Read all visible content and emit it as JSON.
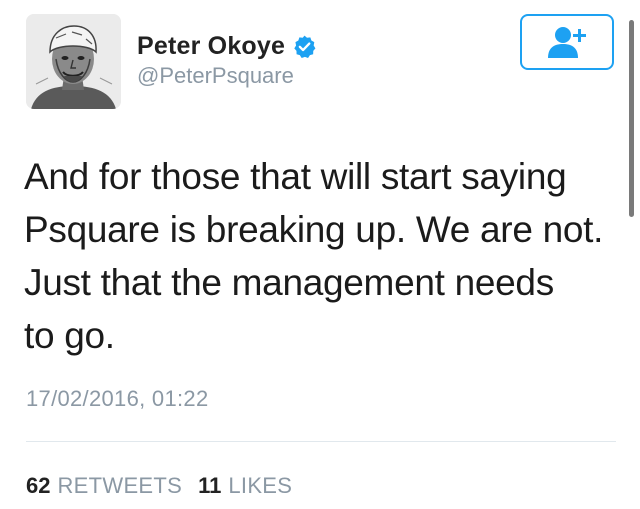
{
  "user": {
    "display_name": "Peter Okoye",
    "handle": "@PeterPsquare",
    "verified": true,
    "avatar_icon": "sketch-portrait-avatar"
  },
  "follow_button": {
    "icon": "add-user-icon",
    "color": "#1da1f2"
  },
  "tweet": {
    "lines": [
      "And for those that will start saying",
      "Psquare is breaking up. We are not.",
      "Just that the management needs",
      "to go."
    ],
    "timestamp": "17/02/2016, 01:22"
  },
  "stats": {
    "retweets_count": "62",
    "retweets_label": "RETWEETS",
    "likes_count": "11",
    "likes_label": "LIKES"
  },
  "colors": {
    "accent": "#1da1f2",
    "secondary_text": "#8b98a4",
    "primary_text": "#1b1b1b",
    "divider": "#e1e8ed"
  }
}
